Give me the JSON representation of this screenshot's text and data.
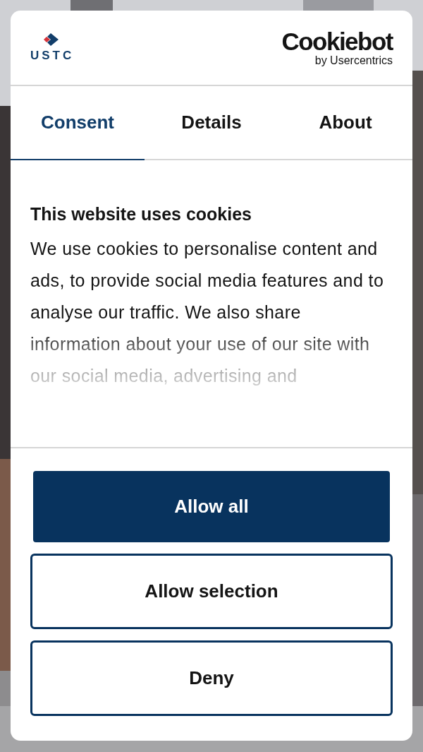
{
  "header": {
    "logo_text": "USTC",
    "brand": "Cookiebot",
    "brand_sub": "by Usercentrics"
  },
  "tabs": [
    {
      "label": "Consent",
      "selected": true
    },
    {
      "label": "Details",
      "selected": false
    },
    {
      "label": "About",
      "selected": false
    }
  ],
  "title": "This website uses cookies",
  "body": "We use cookies to personalise content and ads, to provide social media features and to analyse our traffic. We also share information about your use of our site with our social media, advertising and",
  "buttons": [
    {
      "label": "Allow all",
      "kind": "primary"
    },
    {
      "label": "Allow selection",
      "kind": "outline"
    },
    {
      "label": "Deny",
      "kind": "outline"
    }
  ]
}
